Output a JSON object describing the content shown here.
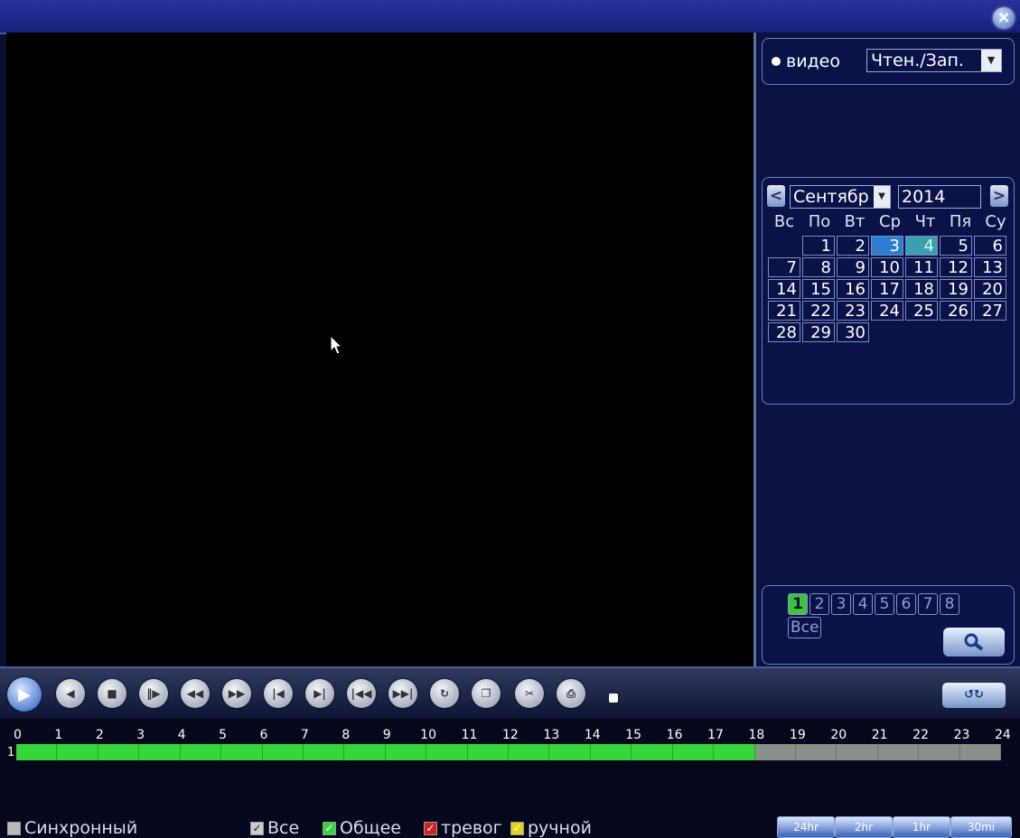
{
  "window": {
    "close_symbol": "×"
  },
  "sidebar": {
    "mode_label": "видео",
    "mode_select": "Чтен./Зап.",
    "calendar": {
      "prev": "<",
      "next": ">",
      "month": "Сентябр",
      "year": "2014",
      "weekdays": [
        "Вс",
        "По",
        "Вт",
        "Ср",
        "Чт",
        "Пя",
        "Су"
      ],
      "days": [
        "",
        "1",
        "2",
        "3",
        "4",
        "5",
        "6",
        "7",
        "8",
        "9",
        "10",
        "11",
        "12",
        "13",
        "14",
        "15",
        "16",
        "17",
        "18",
        "19",
        "20",
        "21",
        "22",
        "23",
        "24",
        "25",
        "26",
        "27",
        "28",
        "29",
        "30"
      ],
      "recorded_blue": "3",
      "recorded_green": "4"
    },
    "channels": [
      "1",
      "2",
      "3",
      "4",
      "5",
      "6",
      "7",
      "8"
    ],
    "active_channel": "1",
    "all_channels": "Все"
  },
  "timeline": {
    "hours": [
      "0",
      "1",
      "2",
      "3",
      "4",
      "5",
      "6",
      "7",
      "8",
      "9",
      "10",
      "11",
      "12",
      "13",
      "14",
      "15",
      "16",
      "17",
      "18",
      "19",
      "20",
      "21",
      "22",
      "23",
      "24"
    ],
    "track_label": "1",
    "recorded_until_hour": 18
  },
  "legend": {
    "sync": "Синхронный",
    "all": "Все",
    "general": "Общее",
    "alarm": "тревог",
    "manual": "ручной"
  },
  "zoom_buttons": [
    "24hr",
    "2hr",
    "1hr",
    "30mi"
  ],
  "colors": {
    "recorded": "#35d63c",
    "empty": "#8a8f8a",
    "alarm": "#d42020",
    "manual": "#e3d11a"
  }
}
